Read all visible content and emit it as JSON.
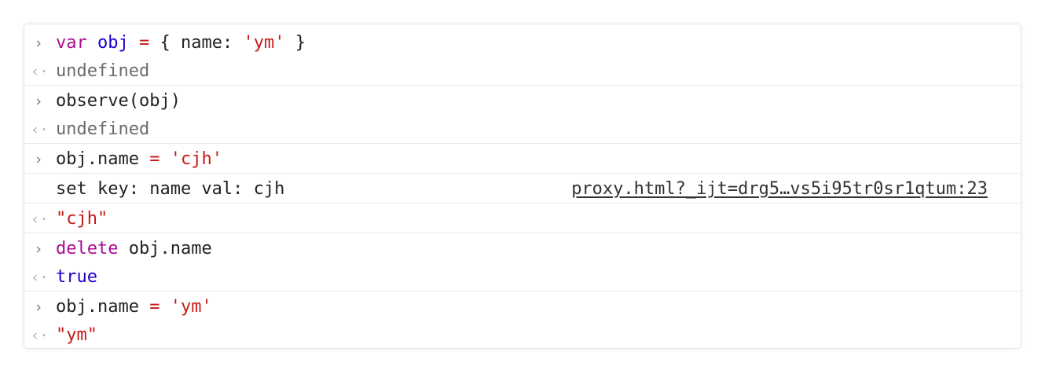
{
  "console": {
    "entries": [
      {
        "type": "input",
        "parts": [
          "var",
          "obj",
          "=",
          "{ name: ",
          "'ym'",
          " }"
        ]
      },
      {
        "type": "output",
        "text": "undefined"
      },
      {
        "type": "input",
        "text": "observe(obj)"
      },
      {
        "type": "output",
        "text": "undefined"
      },
      {
        "type": "input",
        "parts": [
          "obj.name",
          "=",
          "'cjh'"
        ]
      },
      {
        "type": "log",
        "text": "set key: name val: cjh",
        "source": "proxy.html?_ijt=drg5…vs5i95tr0sr1qtum:23"
      },
      {
        "type": "output",
        "text": "\"cjh\""
      },
      {
        "type": "input",
        "parts": [
          "delete",
          "obj.name"
        ]
      },
      {
        "type": "output",
        "text": "true"
      },
      {
        "type": "input",
        "parts": [
          "obj.name",
          "=",
          "'ym'"
        ]
      },
      {
        "type": "output",
        "text": "\"ym\""
      }
    ],
    "input_prompt": "›",
    "output_prompt": "‹·"
  },
  "colors": {
    "keyword": "#aa0d91",
    "variable": "#1c00cf",
    "string": "#c41a16",
    "muted": "#6b6b6b"
  },
  "icons": {
    "input": "chevron-right-icon",
    "output": "return-arrow-icon"
  }
}
